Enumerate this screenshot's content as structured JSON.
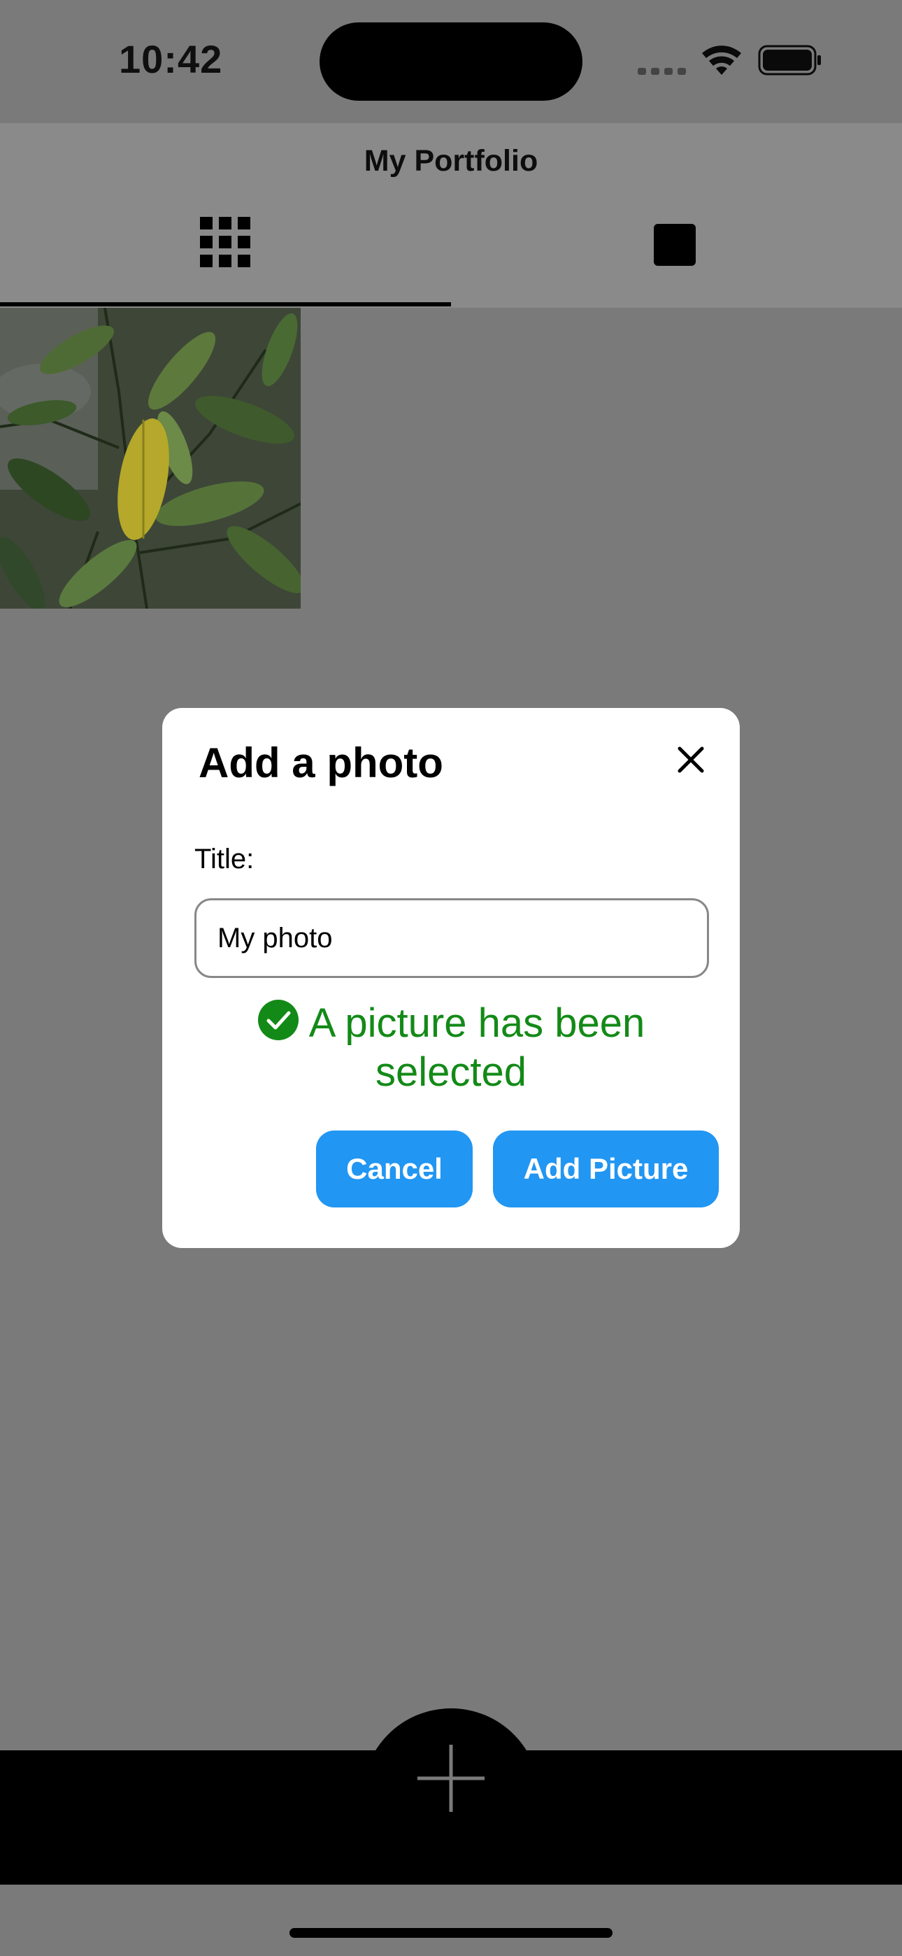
{
  "status_bar": {
    "time": "10:42",
    "icons": [
      "signal-icon",
      "wifi-icon",
      "battery-icon"
    ]
  },
  "header": {
    "title": "My Portfolio",
    "tabs": [
      {
        "icon": "grid-icon",
        "selected": true
      },
      {
        "icon": "square-icon",
        "selected": false
      }
    ]
  },
  "gallery": {
    "photos": [
      {
        "alt": "leaves photo"
      }
    ]
  },
  "dialog": {
    "title": "Add a photo",
    "title_label": "Title:",
    "title_value": "My photo",
    "status_message": "A picture has been selected",
    "cancel_label": "Cancel",
    "add_label": "Add Picture"
  },
  "fab": {
    "icon": "plus-icon"
  },
  "colors": {
    "overlay": "#7a7a7a",
    "button": "#2196f3",
    "success": "#138a17"
  }
}
